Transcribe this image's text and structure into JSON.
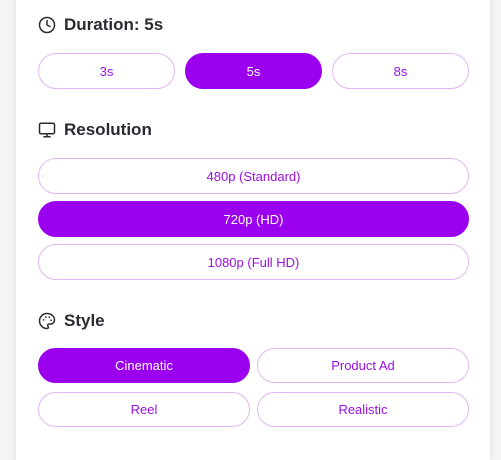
{
  "accent_color": "#9a00ee",
  "duration": {
    "icon": "clock-icon",
    "title": "Duration: 5s",
    "options": [
      {
        "label": "3s",
        "selected": false
      },
      {
        "label": "5s",
        "selected": true
      },
      {
        "label": "8s",
        "selected": false
      }
    ]
  },
  "resolution": {
    "icon": "monitor-icon",
    "title": "Resolution",
    "options": [
      {
        "label": "480p (Standard)",
        "selected": false
      },
      {
        "label": "720p (HD)",
        "selected": true
      },
      {
        "label": "1080p (Full HD)",
        "selected": false
      }
    ]
  },
  "style": {
    "icon": "palette-icon",
    "title": "Style",
    "options": [
      {
        "label": "Cinematic",
        "selected": true
      },
      {
        "label": "Product Ad",
        "selected": false
      },
      {
        "label": "Reel",
        "selected": false
      },
      {
        "label": "Realistic",
        "selected": false
      }
    ]
  }
}
